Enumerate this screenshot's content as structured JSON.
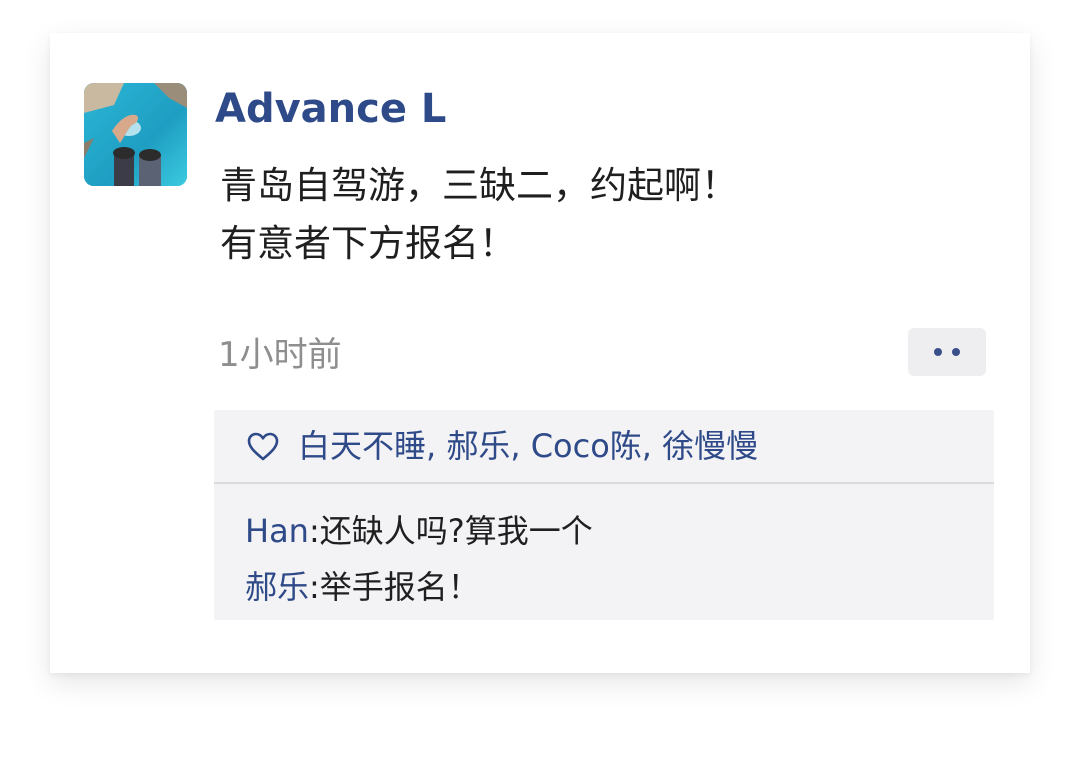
{
  "post": {
    "author": "Advance L",
    "avatar_icon": "profile-photo-hand-over-lagoon",
    "text_lines": [
      "青岛自驾游，三缺二，约起啊！",
      "有意者下方报名！"
    ],
    "time": "1小时前",
    "more_icon": "more-dots-icon"
  },
  "likes": {
    "icon": "heart-outline-icon",
    "names": "白天不睡, 郝乐, Coco陈, 徐慢慢"
  },
  "comments": [
    {
      "author": "Han",
      "separator": ":",
      "text": "还缺人吗?算我一个"
    },
    {
      "author": "郝乐",
      "separator": ":",
      "text": "举手报名！"
    }
  ],
  "colors": {
    "name_blue": "#2f4a88",
    "text": "#1f1f1f",
    "muted": "#8e8e8e",
    "panel_bg": "#f3f2f5"
  }
}
